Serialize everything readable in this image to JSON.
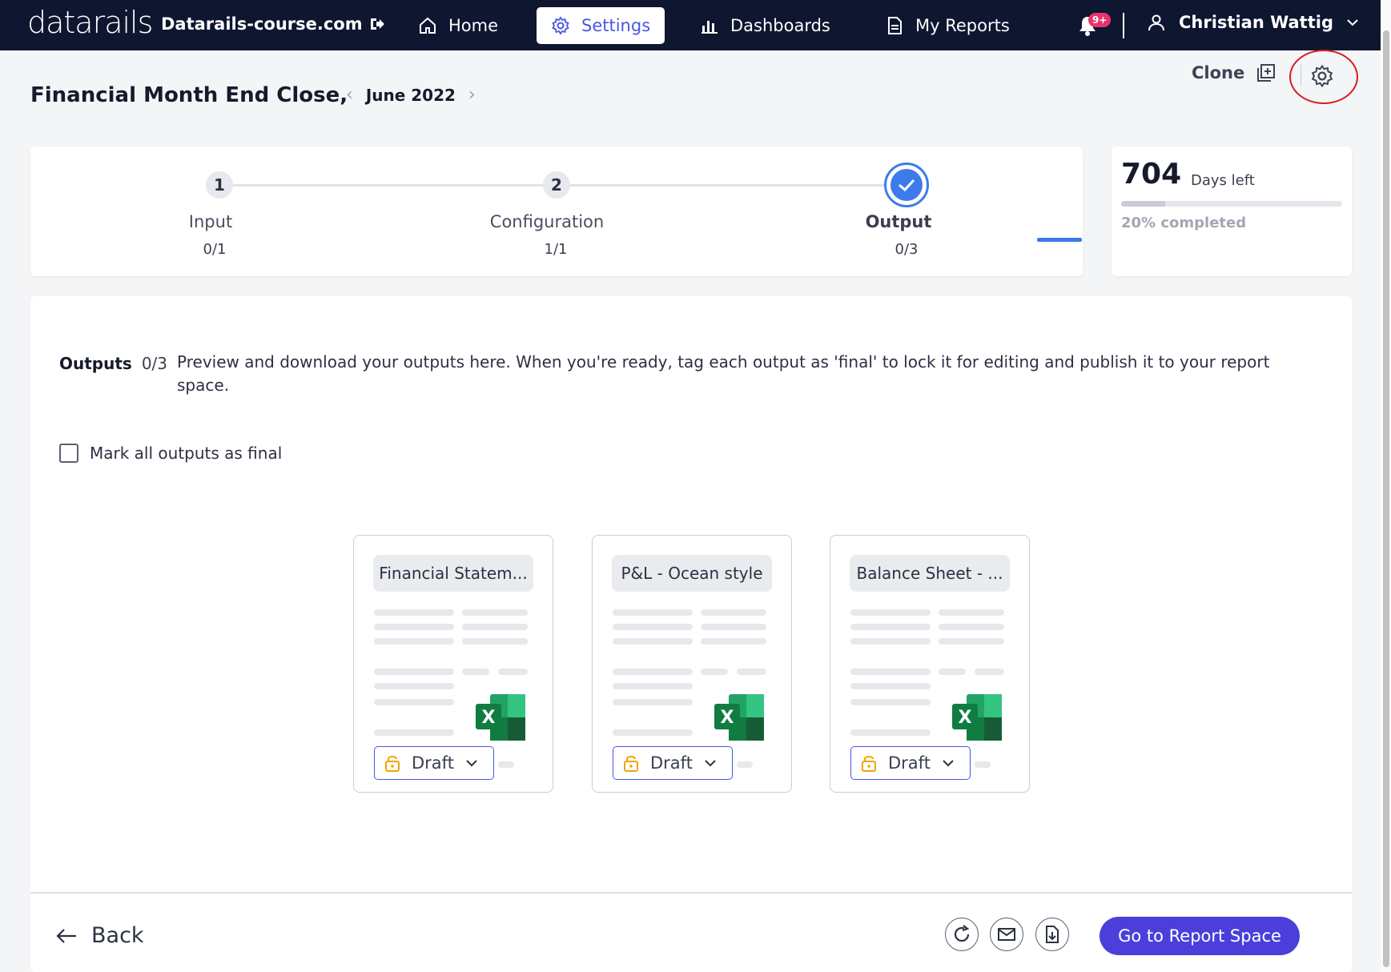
{
  "nav": {
    "logo": "datarails",
    "domain": "Datarails-course.com",
    "items": [
      {
        "label": "Home",
        "icon": "home-icon"
      },
      {
        "label": "Settings",
        "icon": "gear-icon"
      },
      {
        "label": "Dashboards",
        "icon": "bar-chart-icon"
      },
      {
        "label": "My Reports",
        "icon": "document-icon"
      }
    ],
    "notification_badge": "9+",
    "user_name": "Christian Wattig"
  },
  "header": {
    "title": "Financial Month End Close,",
    "month": "June 2022",
    "clone_label": "Clone"
  },
  "stepper": {
    "steps": [
      {
        "number": "1",
        "label": "Input",
        "count": "0/1"
      },
      {
        "number": "2",
        "label": "Configuration",
        "count": "1/1"
      },
      {
        "number": "",
        "label": "Output",
        "count": "0/3"
      }
    ]
  },
  "days": {
    "value": "704",
    "label": "Days left",
    "completed_label": "20% completed",
    "progress": 0.2
  },
  "outputs": {
    "title": "Outputs",
    "count": "0/3",
    "description": "Preview and download your outputs here. When you're ready, tag each output as 'final' to lock it for editing and publish it to your report space.",
    "mark_all_label": "Mark all outputs as final",
    "cards": [
      {
        "title": "Financial Statem...",
        "status": "Draft"
      },
      {
        "title": "P&L - Ocean style",
        "status": "Draft"
      },
      {
        "title": "Balance Sheet - ...",
        "status": "Draft"
      }
    ]
  },
  "footer": {
    "back_label": "Back",
    "go_label": "Go to Report Space"
  },
  "colors": {
    "nav_bg": "#0e1630",
    "accent": "#4a56e2",
    "primary_button": "#4a3fdb",
    "step_done": "#3d7bea",
    "highlight_ring": "#d71c1c"
  }
}
